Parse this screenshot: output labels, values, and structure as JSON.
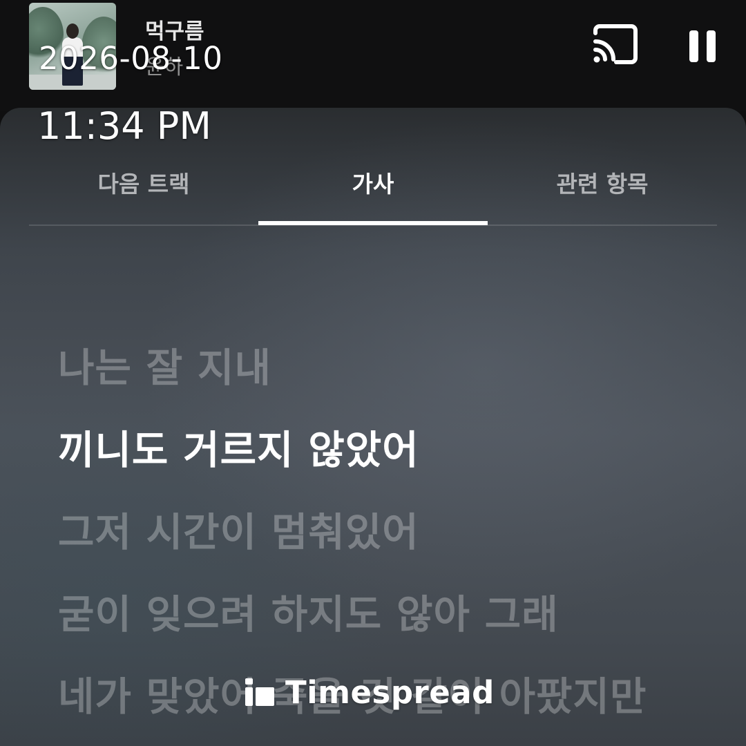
{
  "now_playing": {
    "title": "먹구름",
    "artist": "윤하"
  },
  "overlay": {
    "date": "2026-08-10",
    "time": "11:34 PM"
  },
  "tabs": [
    {
      "label": "다음 트랙",
      "active": false
    },
    {
      "label": "가사",
      "active": true
    },
    {
      "label": "관련 항목",
      "active": false
    }
  ],
  "lyrics": [
    {
      "text": "나는 잘 지내",
      "current": false
    },
    {
      "text": "끼니도 거르지 않았어",
      "current": true
    },
    {
      "text": "그저 시간이 멈춰있어",
      "current": false
    },
    {
      "text": "굳이 잊으려 하지도 않아 그래",
      "current": false
    },
    {
      "text": "네가 맞았어 죽을 것 같이 아팠지만",
      "current": false
    }
  ],
  "icons": {
    "cast": "cast-icon",
    "pause": "pause-icon",
    "watermark": "timespread-logo-icon"
  },
  "watermark": {
    "text": "Timespread"
  },
  "colors": {
    "active_text": "#ffffff",
    "inactive_tab": "#b3b5b8",
    "inactive_lyric": "rgba(255,255,255,0.28)",
    "sheet_bg": "#4c525a"
  }
}
